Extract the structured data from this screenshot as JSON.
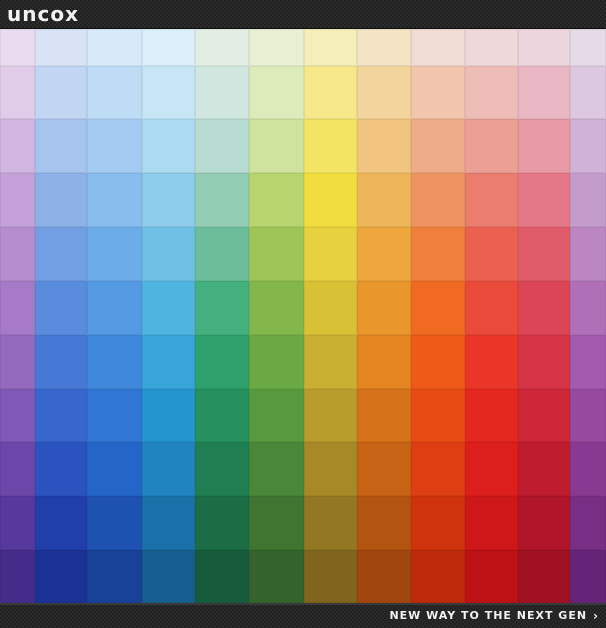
{
  "header": {
    "logo_text": "uncox"
  },
  "footer": {
    "tagline": "NEW WAY TO THE NEXT GEN",
    "chevron_icon": "chevron-right-icon"
  },
  "swatches": {
    "columns": 12,
    "rows": 11,
    "colors": [
      [
        "#eadcee",
        "#d9e3f5",
        "#d8eaf9",
        "#dbeefa",
        "#e2eee3",
        "#e9efd3",
        "#f4eeba",
        "#f2e4c4",
        "#f0dcd4",
        "#eed8da",
        "#ecd6de",
        "#e4dae8"
      ],
      [
        "#e0cce8",
        "#c2d5f3",
        "#bedcf6",
        "#c6e6f6",
        "#cfe7df",
        "#ddebba",
        "#f7e88c",
        "#f3d49c",
        "#f1c6ad",
        "#eebdb8",
        "#eab8c4",
        "#dcc8e0"
      ],
      [
        "#d1b6e1",
        "#a7c4ee",
        "#a4ccf2",
        "#abdaf1",
        "#b8dbd1",
        "#cfe29e",
        "#f4e464",
        "#f1c57f",
        "#efac8a",
        "#ec9f94",
        "#e89aa5",
        "#cfb2d6"
      ],
      [
        "#c4a2d9",
        "#8db2e8",
        "#88bdee",
        "#8dcdeb",
        "#93cdb4",
        "#b7d46e",
        "#f1dd3d",
        "#efb659",
        "#ef9461",
        "#ea7d6e",
        "#e57887",
        "#c49ccc"
      ],
      [
        "#b68ed0",
        "#729fe3",
        "#6cace9",
        "#6ec1e5",
        "#6bbe99",
        "#9dc557",
        "#e7d13f",
        "#eea63d",
        "#ef7f3b",
        "#ea6150",
        "#e05c6b",
        "#bb86c2"
      ],
      [
        "#a67ac7",
        "#5a8cde",
        "#539ae3",
        "#50b4e0",
        "#45b07f",
        "#84b74b",
        "#d7c236",
        "#e9962b",
        "#f06a22",
        "#ea4a39",
        "#db4556",
        "#b070b8"
      ],
      [
        "#946abf",
        "#4679d6",
        "#3f88dc",
        "#37a5da",
        "#2da06b",
        "#6ba944",
        "#c9b033",
        "#e38520",
        "#ef5a18",
        "#ea3628",
        "#d53346",
        "#a45aae"
      ],
      [
        "#8058b5",
        "#3766cc",
        "#2f77d3",
        "#2595cf",
        "#26915e",
        "#58993e",
        "#b89d2c",
        "#d6731a",
        "#e94b14",
        "#e42820",
        "#cc2638",
        "#97489f"
      ],
      [
        "#6b47a9",
        "#2a53bf",
        "#2466c7",
        "#1f84bf",
        "#1f7f52",
        "#4b8738",
        "#a68a27",
        "#c66315",
        "#de3e11",
        "#dc1e1c",
        "#c01c30",
        "#883a92"
      ],
      [
        "#57389c",
        "#213faa",
        "#1d52b1",
        "#1a70a8",
        "#1b6d46",
        "#3f7531",
        "#937722",
        "#b45411",
        "#cf330e",
        "#ce1718",
        "#b01529",
        "#782e85"
      ],
      [
        "#462c8a",
        "#1b3196",
        "#184298",
        "#175e90",
        "#165c3c",
        "#34642b",
        "#80661d",
        "#a1470e",
        "#bd2a0c",
        "#bd1215",
        "#9f1123",
        "#662478"
      ]
    ]
  }
}
